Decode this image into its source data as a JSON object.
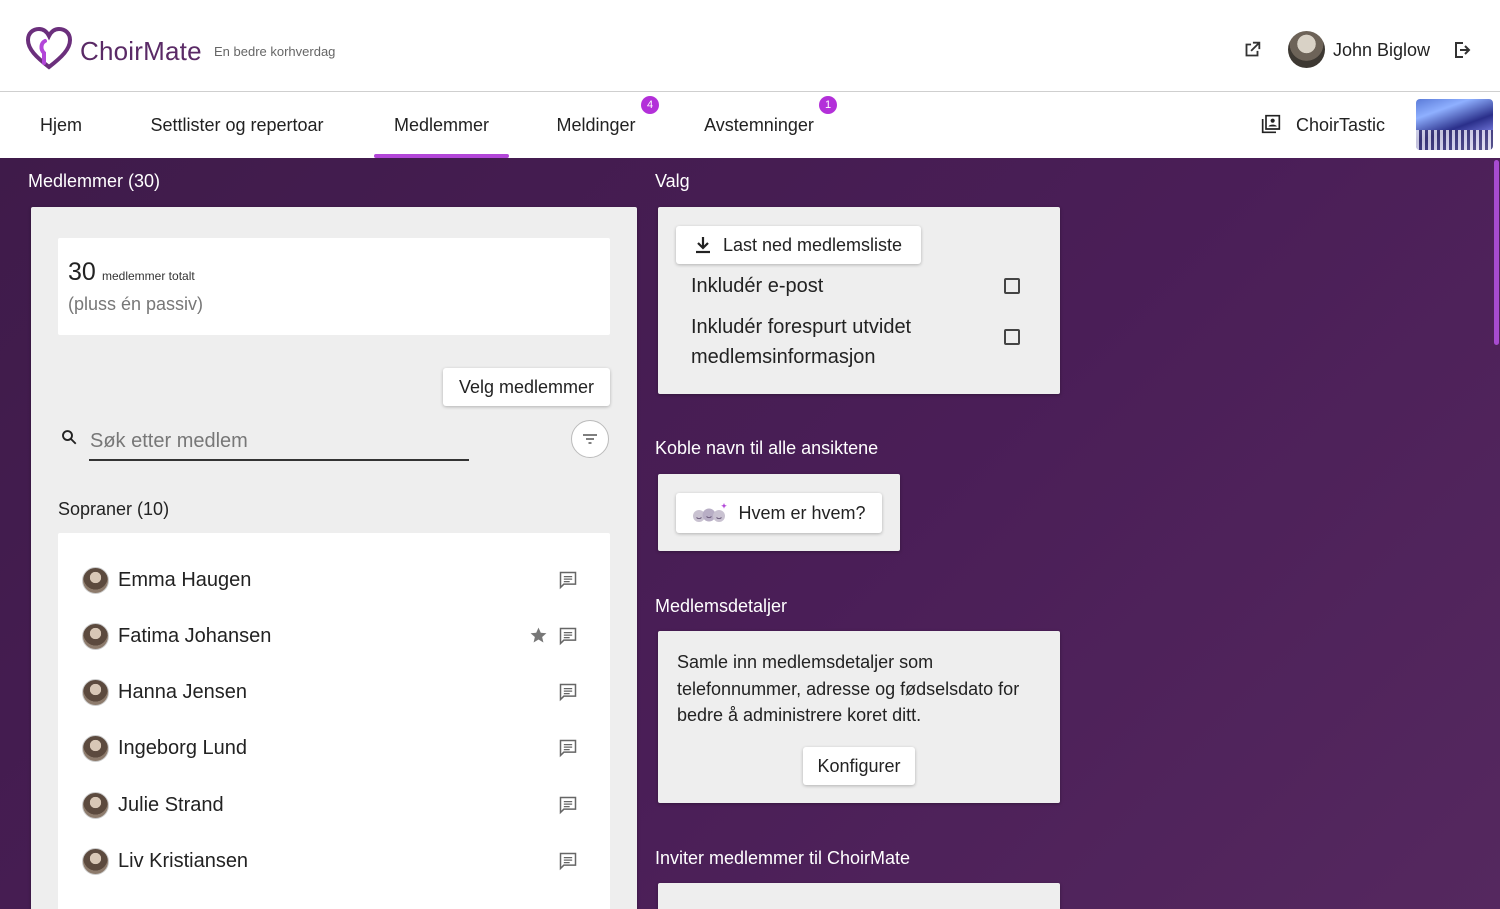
{
  "header": {
    "brand": "ChoirMate",
    "tagline": "En bedre korhverdag",
    "user_name": "John Biglow"
  },
  "nav": {
    "tabs": [
      {
        "label": "Hjem"
      },
      {
        "label": "Settlister og repertoar"
      },
      {
        "label": "Medlemmer",
        "active": true
      },
      {
        "label": "Meldinger",
        "badge": "4"
      },
      {
        "label": "Avstemninger",
        "badge": "1"
      }
    ],
    "choir_name": "ChoirTastic"
  },
  "members": {
    "title": "Medlemmer (30)",
    "total_count": "30",
    "total_label": "medlemmer totalt",
    "passive_note": "(pluss én passiv)",
    "select_button": "Velg medlemmer",
    "search_placeholder": "Søk etter medlem",
    "group_title": "Sopraner (10)",
    "list": [
      {
        "name": "Emma Haugen",
        "starred": false
      },
      {
        "name": "Fatima Johansen",
        "starred": true
      },
      {
        "name": "Hanna Jensen",
        "starred": false
      },
      {
        "name": "Ingeborg Lund",
        "starred": false
      },
      {
        "name": "Julie Strand",
        "starred": false
      },
      {
        "name": "Liv Kristiansen",
        "starred": false
      }
    ]
  },
  "options": {
    "title": "Valg",
    "download_button": "Last ned medlemsliste",
    "include_email": "Inkludér e-post",
    "include_extended": "Inkludér forespurt utvidet medlemsinformasjon"
  },
  "faces": {
    "title": "Koble navn til alle ansiktene",
    "button": "Hvem er hvem?"
  },
  "details": {
    "title": "Medlemsdetaljer",
    "text": "Samle inn medlemsdetaljer som telefonnummer, adresse og fødselsdato for bedre å administrere koret ditt.",
    "button": "Konfigurer"
  },
  "invite": {
    "title": "Inviter medlemmer til ChoirMate"
  },
  "colors": {
    "accent": "#b246d8",
    "background": "#45204f"
  }
}
